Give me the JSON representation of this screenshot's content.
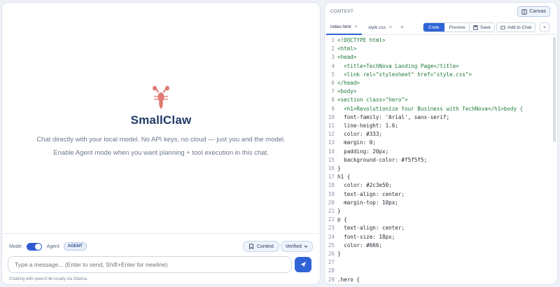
{
  "chat": {
    "app_name": "SmallClaw",
    "subtitle1": "Chat directly with your local model. No API keys, no cloud — just you and the model.",
    "subtitle2": "Enable Agent mode when you want planning + tool execution in this chat.",
    "mode_label": "Mode:",
    "agent_label": "Agent",
    "agent_badge": "AGENT",
    "context_button": "Context",
    "verified_button": "Verified",
    "input_placeholder": "Type a message... (Enter to send, Shift+Enter for newline)",
    "status": "Chatting with qwen3:4b locally via Ollama."
  },
  "context": {
    "label": "CONTEXT",
    "canvas_button": "Canvas",
    "tabs": [
      {
        "label": "index.html",
        "close": "×"
      },
      {
        "label": "style.css",
        "close": "×"
      }
    ],
    "add_tab": "+",
    "view_code": "Code",
    "view_preview": "Preview",
    "save_button": "Save",
    "add_to_chat_button": "Add to Chat",
    "close_button": "×"
  },
  "code_lines": [
    {
      "n": "1",
      "t": "<!DOCTYPE html>"
    },
    {
      "n": "2",
      "t": "<html>"
    },
    {
      "n": "3",
      "t": "<head>"
    },
    {
      "n": "4",
      "t": "  <title>TechNova Landing Page</title>"
    },
    {
      "n": "5",
      "t": "  <link rel=\"stylesheet\" href=\"style.css\">"
    },
    {
      "n": "6",
      "t": "</head>"
    },
    {
      "n": "7",
      "t": "<body>"
    },
    {
      "n": "8",
      "t": "<section class=\"hero\">"
    },
    {
      "n": "9",
      "t": "  <h1>Revolutionize Your Business with TechNova</h1>body {"
    },
    {
      "n": "10",
      "t": "  font-family: 'Arial', sans-serif;"
    },
    {
      "n": "11",
      "t": "  line-height: 1.6;"
    },
    {
      "n": "12",
      "t": "  color: #333;"
    },
    {
      "n": "13",
      "t": "  margin: 0;"
    },
    {
      "n": "14",
      "t": "  padding: 20px;"
    },
    {
      "n": "15",
      "t": "  background-color: #f5f5f5;"
    },
    {
      "n": "16",
      "t": "}"
    },
    {
      "n": "17",
      "t": "h1 {"
    },
    {
      "n": "18",
      "t": "  color: #2c3e50;"
    },
    {
      "n": "19",
      "t": "  text-align: center;"
    },
    {
      "n": "20",
      "t": "  margin-top: 10px;"
    },
    {
      "n": "21",
      "t": "}"
    },
    {
      "n": "22",
      "t": "p {"
    },
    {
      "n": "23",
      "t": "  text-align: center;"
    },
    {
      "n": "24",
      "t": "  font-size: 18px;"
    },
    {
      "n": "25",
      "t": "  color: #666;"
    },
    {
      "n": "26",
      "t": "}"
    },
    {
      "n": "27",
      "t": ""
    },
    {
      "n": "28",
      "t": ""
    },
    {
      "n": "29",
      "t": ".hero {"
    }
  ],
  "colors": {
    "accent": "#2f63d6",
    "title": "#1f3a66",
    "lobster": "#e07b73"
  },
  "icons": [
    "lobster-logo-icon",
    "context-icon",
    "chevron-down-icon",
    "send-icon",
    "canvas-icon",
    "save-icon",
    "add-to-chat-icon"
  ]
}
